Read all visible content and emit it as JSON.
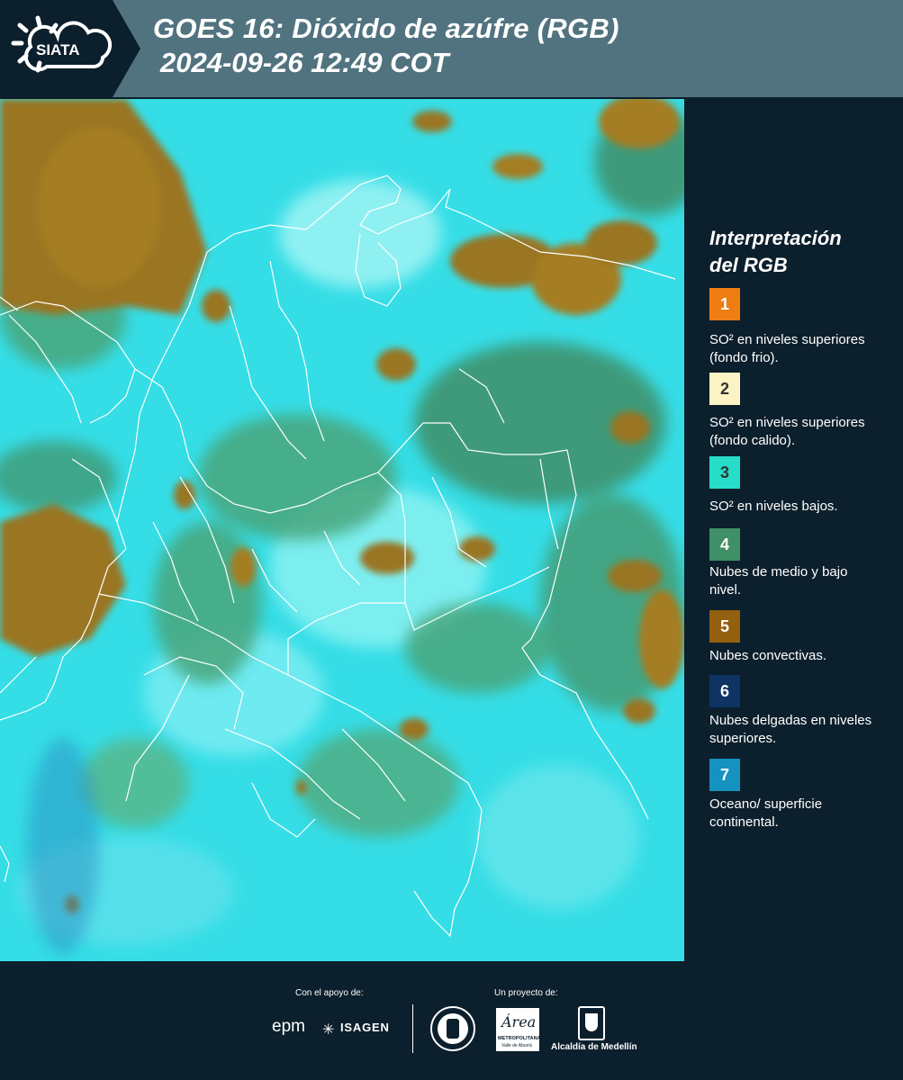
{
  "header": {
    "logo_text": "SIATA",
    "title_line1": "GOES 16: Dióxido de azúfre (RGB)",
    "title_line2": "2024-09-26 12:49 COT"
  },
  "legend": {
    "title_line1": "Interpretación",
    "title_line2": "del RGB",
    "items": [
      {
        "num": "1",
        "label": "SO² en niveles superiores (fondo frio).",
        "color": "#f07d13"
      },
      {
        "num": "2",
        "label": "SO² en niveles superiores (fondo calido).",
        "color": "#fcf3c5"
      },
      {
        "num": "3",
        "label": "SO² en niveles bajos.",
        "color": "#27dcc8"
      },
      {
        "num": "4",
        "label": "Nubes de medio y bajo nivel.",
        "color": "#3f8f67"
      },
      {
        "num": "5",
        "label": "Nubes convectivas.",
        "color": "#93600f"
      },
      {
        "num": "6",
        "label": "Nubes delgadas en niveles superiores.",
        "color": "#0d3463"
      },
      {
        "num": "7",
        "label": "Oceano/ superficie continental.",
        "color": "#1692c0"
      }
    ]
  },
  "footer": {
    "support_label": "Con el apoyo de:",
    "project_label": "Un proyecto de:",
    "sponsor1": "epm",
    "sponsor2": "ISAGEN",
    "partner1": "Área",
    "partner1_sub": "METROPOLITANA",
    "partner1_sub2": "Valle de Aburrá",
    "partner2": "Alcaldía de Medellín"
  },
  "colors": {
    "background": "#0c1f2c",
    "header": "#51737f",
    "map_base": "#30d8e0",
    "cloud_brown": "#9a7420",
    "cloud_green": "#3f8f67"
  }
}
